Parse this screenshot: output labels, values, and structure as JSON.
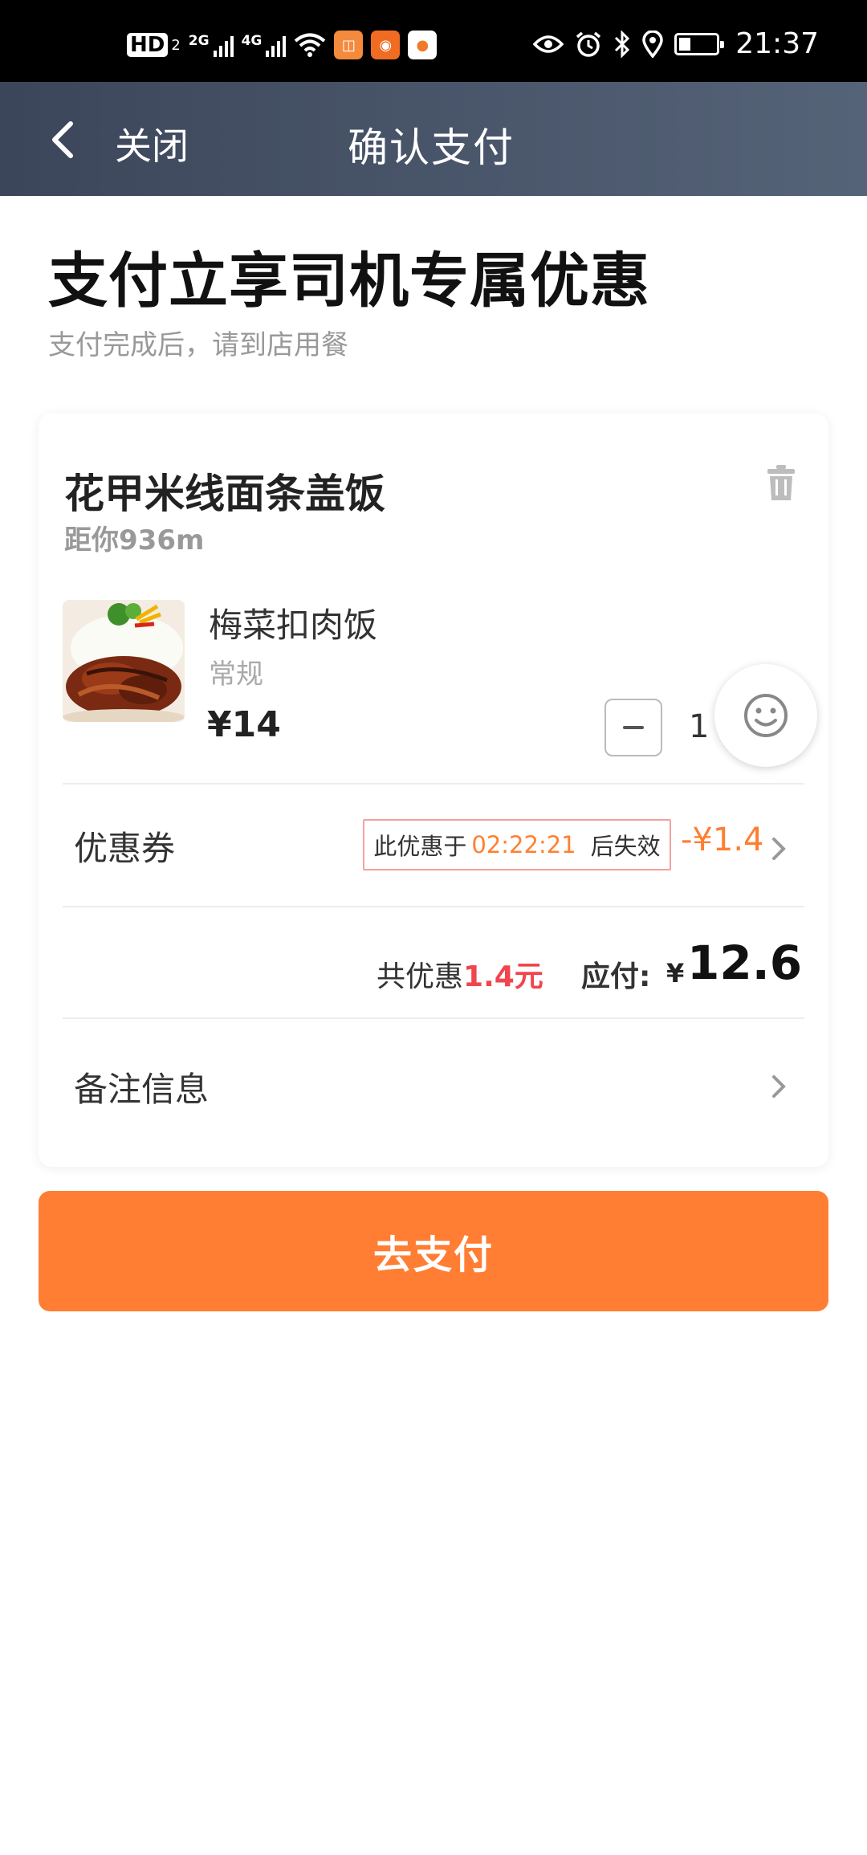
{
  "status_bar": {
    "hd_label": "HD",
    "hd_sub": "2",
    "signal_1_label": "2G",
    "signal_2_label": "4G",
    "time": "21:37",
    "icons": [
      "eye-icon",
      "alarm-icon",
      "bluetooth-icon",
      "location-icon",
      "battery-icon"
    ]
  },
  "nav": {
    "close_label": "关闭",
    "title": "确认支付"
  },
  "hero": {
    "title": "支付立享司机专属优惠",
    "subtitle": "支付完成后，请到店用餐"
  },
  "shop": {
    "name": "花甲米线面条盖饭",
    "distance": "距你936m"
  },
  "item": {
    "name": "梅菜扣肉饭",
    "spec": "常规",
    "price": "¥14",
    "quantity": "1"
  },
  "coupon": {
    "label": "优惠券",
    "prefix": "此优惠于",
    "timer": "02:22:21",
    "suffix": "后失效",
    "amount": "-¥1.4"
  },
  "total": {
    "saved_prefix": "共优惠",
    "saved_value": "1.4元",
    "pay_label": "应付:",
    "currency": "¥",
    "pay_value": "12.6"
  },
  "remark": {
    "label": "备注信息"
  },
  "pay_button": {
    "label": "去支付"
  },
  "colors": {
    "accent": "#ff7e33",
    "nav_bg": "#3c465a",
    "discount_red": "#f0454f",
    "coupon_orange": "#ff8030"
  }
}
